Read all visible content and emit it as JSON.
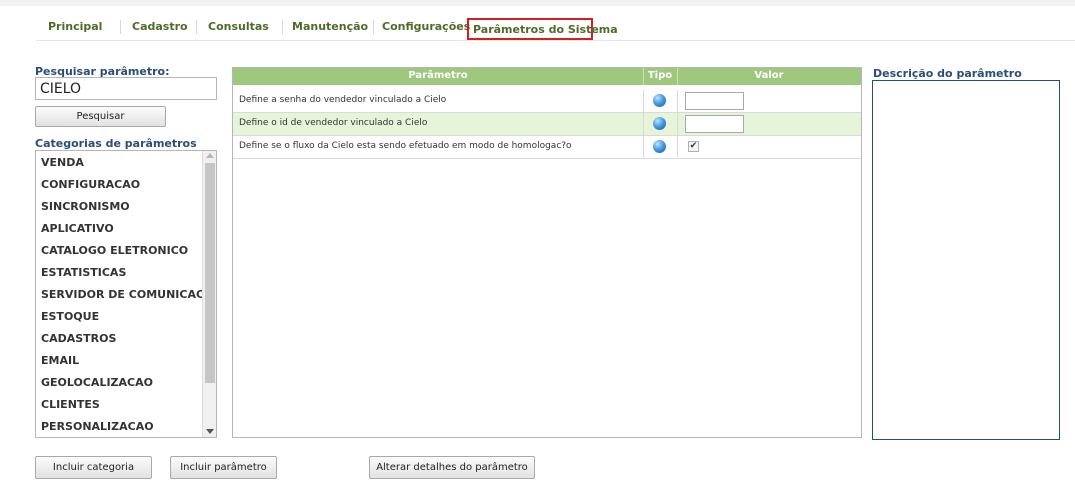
{
  "nav": {
    "items": [
      "Principal",
      "Cadastro",
      "Consultas",
      "Manutenção",
      "Configurações"
    ],
    "active": "Parâmetros do Sistema"
  },
  "search": {
    "label": "Pesquisar parâmetro:",
    "value": "CIELO",
    "button": "Pesquisar"
  },
  "categories": {
    "label": "Categorias de parâmetros",
    "items": [
      "VENDA",
      "CONFIGURACAO",
      "SINCRONISMO",
      "APLICATIVO",
      "CATALOGO ELETRONICO",
      "ESTATISTICAS",
      "SERVIDOR DE COMUNICACAO",
      "ESTOQUE",
      "CADASTROS",
      "EMAIL",
      "GEOLOCALIZACAO",
      "CLIENTES",
      "PERSONALIZACAO"
    ]
  },
  "table": {
    "headers": {
      "param": "Parâmetro",
      "tipo": "Tipo",
      "valor": "Valor"
    },
    "rows": [
      {
        "text": "Define a senha do vendedor vinculado a Cielo",
        "value_type": "text",
        "value": ""
      },
      {
        "text": "Define o id de vendedor vinculado a Cielo",
        "value_type": "text",
        "value": ""
      },
      {
        "text": "Define se o fluxo da Cielo esta sendo efetuado em modo de homologac?o",
        "value_type": "checkbox",
        "checked": true
      }
    ]
  },
  "description": {
    "label": "Descrição do parâmetro"
  },
  "buttons": {
    "incluir_categoria": "Incluir categoria",
    "incluir_parametro": "Incluir parâmetro",
    "alterar_detalhes": "Alterar detalhes do parâmetro"
  },
  "colors": {
    "accent_green": "#9fc77e",
    "nav_text": "#4f6b2a",
    "label_blue": "#2b4d7a",
    "active_border": "#d21f1f",
    "alt_row": "#e6f4da"
  },
  "icons": {
    "tipo": "globe-icon",
    "check": "checkmark-icon"
  }
}
